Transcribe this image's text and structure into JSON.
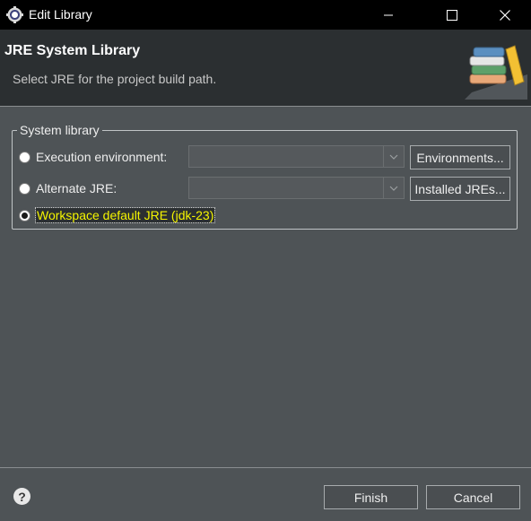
{
  "window": {
    "title": "Edit Library",
    "icon": "eclipse-gear-icon"
  },
  "header": {
    "title": "JRE System Library",
    "message": "Select JRE for the project build path.",
    "image": "books-library-icon"
  },
  "group": {
    "label": "System library",
    "options": [
      {
        "label": "Execution environment:",
        "checked": false
      },
      {
        "label": "Alternate JRE:",
        "checked": false
      },
      {
        "label": "Workspace default JRE (jdk-23)",
        "checked": true
      }
    ],
    "execution_combo_value": "",
    "alternate_combo_value": "",
    "environments_button": "Environments...",
    "installed_jres_button": "Installed JREs..."
  },
  "footer": {
    "help_label": "?",
    "finish_button": "Finish",
    "cancel_button": "Cancel"
  }
}
